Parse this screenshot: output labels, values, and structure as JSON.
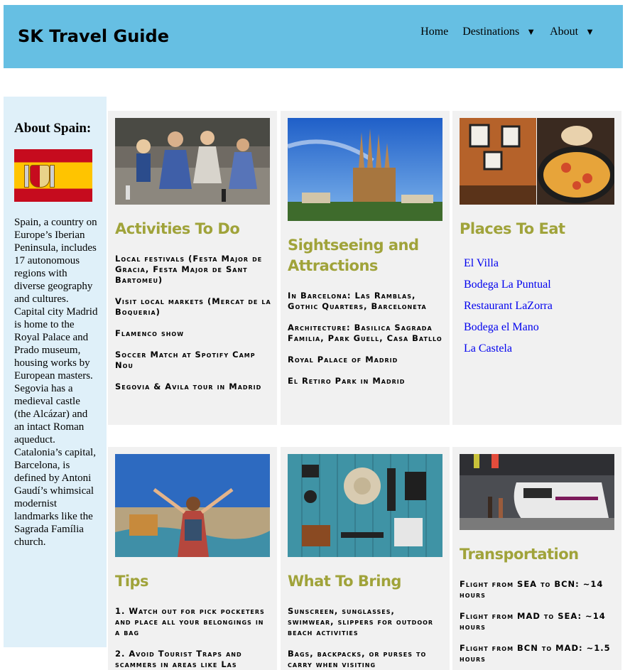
{
  "header": {
    "brand": "SK Travel Guide",
    "nav": [
      {
        "label": "Home",
        "caret": ""
      },
      {
        "label": "Destinations",
        "caret": "▼"
      },
      {
        "label": "About",
        "caret": "▼"
      }
    ]
  },
  "sidebar": {
    "title": "About Spain:",
    "text": "Spain, a country on Europe’s Iberian Peninsula, includes 17 autonomous regions with diverse geography and cultures. Capital city Madrid is home to the Royal Palace and Prado museum, housing works by European masters. Segovia has a medieval castle (the Alcázar) and an intact Roman aqueduct. Catalonia’s capital, Barcelona, is defined by Antoni Gaudí’s whimsical modernist landmarks like the Sagrada Família church."
  },
  "cards": {
    "activities": {
      "title": "Activities To Do",
      "items": [
        "Local festivals (Festa Major de Gracia, Festa Major de Sant Bartomeu)",
        "Visit local markets (Mercat de la Boqueria)",
        "Flamenco show",
        "Soccer Match at Spotify Camp Nou",
        "Segovia & Avila tour in Madrid"
      ]
    },
    "sightseeing": {
      "title": "Sightseeing and Attractions",
      "items": [
        "In Barcelona: Las Ramblas, Gothic Quarters, Barceloneta",
        "Architecture: Basilica Sagrada Familia, Park Guell, Casa Batllo",
        "Royal Palace of Madrid",
        "El Retiro Park in Madrid"
      ]
    },
    "eat": {
      "title": "Places To Eat",
      "links": [
        "El Villa",
        "Bodega La Puntual",
        "Restaurant LaZorra",
        "Bodega el Mano",
        "La Castela"
      ]
    },
    "tips": {
      "title": "Tips",
      "items": [
        "1. Watch out for pick pocketers and place all your belongings in a bag",
        "2. Avoid Tourist Traps and scammers in areas like Las"
      ]
    },
    "bring": {
      "title": "What To Bring",
      "items": [
        "Sunscreen, sunglasses, swimwear, slippers for outdoor beach activities",
        "Bags, backpacks, or purses to carry when visiting"
      ]
    },
    "transport": {
      "title": "Transportation",
      "items": [
        "Flight from SEA to BCN: ~14 hours",
        "Flight from MAD to SEA: ~14 hours",
        "Flight from BCN to MAD: ~1.5 hours"
      ]
    }
  },
  "colors": {
    "header_bg": "#66bfe3",
    "sidebar_bg": "#dff0f9",
    "card_bg": "#f1f1f1",
    "heading": "#a0a33a",
    "link": "#0000ee"
  }
}
